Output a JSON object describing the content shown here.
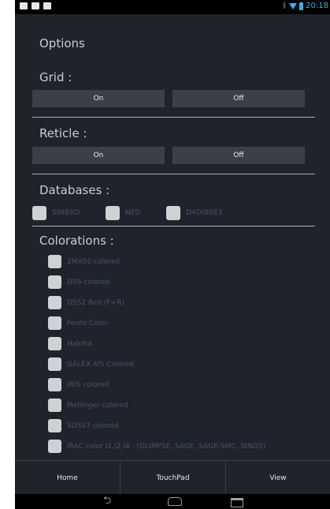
{
  "status_bar": {
    "time": "20:18"
  },
  "options_title": "Options",
  "grid": {
    "label": "Grid :",
    "on_label": "On",
    "off_label": "Off"
  },
  "reticle": {
    "label": "Reticle :",
    "on_label": "On",
    "off_label": "Off"
  },
  "databases": {
    "label": "Databases :",
    "items": [
      "SIMBAD",
      "NED",
      "DATABSE3"
    ]
  },
  "colorations": {
    "label": "Colorations :",
    "items": [
      "2MASS colored",
      "DSS colored",
      "DSS2 Red (F+R)",
      "Fermi Color",
      "Halpha",
      "GALEX AIS Colored",
      "IRIS colored",
      "Mellinger colored",
      "SDSS7 colored",
      "IRAC color I1,I2,I4 - (GLIMPSE, SAGE, SAGE-SMC, SINGS)"
    ]
  },
  "tabs": {
    "home": "Home",
    "touchpad": "TouchPad",
    "view": "View"
  },
  "colors": {
    "background": "#1e232c",
    "button": "#3a3f48",
    "accent": "#33b5e5"
  }
}
